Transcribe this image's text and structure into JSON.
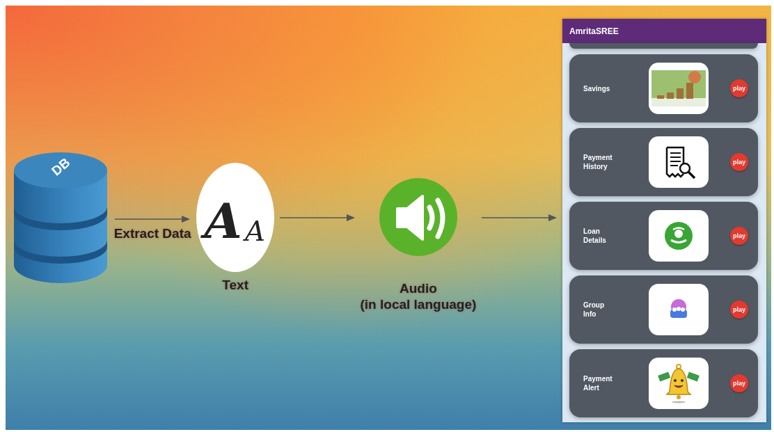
{
  "flow": [
    {
      "kind": "database",
      "label": "DB"
    },
    {
      "kind": "arrow",
      "caption": "Extract Data"
    },
    {
      "kind": "text",
      "glyphs": [
        "A",
        "A"
      ],
      "caption": "Text"
    },
    {
      "kind": "arrow"
    },
    {
      "kind": "audio",
      "caption": "Audio\n(in local language)"
    },
    {
      "kind": "arrow"
    }
  ],
  "app": {
    "title": "AmritaSREE",
    "cards": [
      {
        "label": "Savings",
        "kind": "coins",
        "action": "play"
      },
      {
        "label": "Payment History",
        "kind": "receipt",
        "action": "play"
      },
      {
        "label": "Loan Details",
        "kind": "loan",
        "action": "play"
      },
      {
        "label": "Group Info",
        "kind": "group",
        "action": "play"
      },
      {
        "label": "Payment Alert",
        "kind": "bell",
        "action": "play"
      }
    ]
  }
}
